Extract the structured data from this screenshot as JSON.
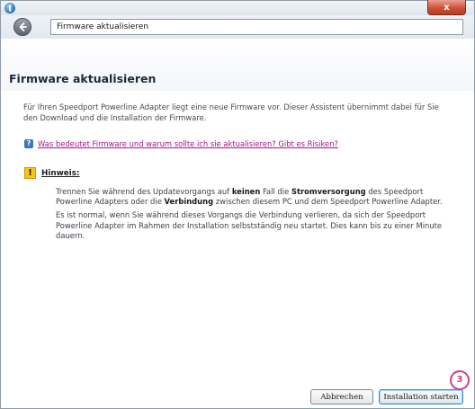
{
  "window": {
    "close_label": "x"
  },
  "nav": {
    "address": "Firmware aktualisieren"
  },
  "page": {
    "title": "Firmware aktualisieren",
    "intro": "Für Ihren Speedport Powerline Adapter liegt eine neue Firmware vor. Dieser Assistent übernimmt dabei für Sie den Download und die Installation der Firmware.",
    "help_link": "Was bedeutet Firmware und warum sollte ich sie aktualisieren? Gibt es Risiken?"
  },
  "note": {
    "title": "Hinweis:",
    "p1": [
      "Trennen Sie während des Updatevorgangs auf ",
      "keinen",
      " Fall die ",
      "Stromversorgung",
      " des Speedport Powerline Adapters oder die ",
      "Verbindung",
      " zwischen diesem PC und dem Speedport Powerline Adapter."
    ],
    "p2": "Es ist normal, wenn Sie während dieses Vorgangs die Verbindung verlieren, da sich der Speedport Powerline Adapter im Rahmen der Installation selbstständig neu startet. Dies kann bis zu einer Minute dauern."
  },
  "buttons": {
    "cancel": "Abbrechen",
    "install": "Installation starten"
  },
  "annotation": {
    "step": "3"
  },
  "icons": {
    "app": "app-globe-icon",
    "back": "back-arrow-icon",
    "help": "help-question-icon",
    "warning": "warning-exclamation-icon"
  }
}
